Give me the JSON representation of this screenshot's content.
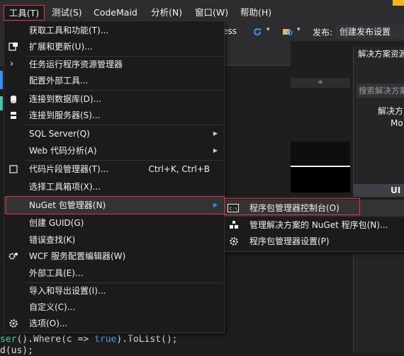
{
  "menubar": {
    "tools": "工具(T)",
    "test": "测试(S)",
    "codemaid": "CodeMaid",
    "analyze": "分析(N)",
    "window": "窗口(W)",
    "help": "帮助(H)"
  },
  "toolbar": {
    "config_suffix": "ess",
    "publish_label": "发布:",
    "publish_value": "创建发布设置"
  },
  "solution_explorer": {
    "title": "解决方案资源",
    "search_placeholder": "搜索解决方案",
    "items": [
      "解决方",
      "Mo",
      "UI"
    ]
  },
  "tools_menu": {
    "items": [
      {
        "label": "获取工具和功能(T)...",
        "icon": "none"
      },
      {
        "label": "扩展和更新(U)...",
        "icon": "extensions-icon"
      },
      {
        "label": "任务运行程序资源管理器",
        "icon": "chevron-right-icon"
      },
      {
        "label": "配置外部工具...",
        "icon": "none"
      },
      {
        "label": "连接到数据库(D)...",
        "icon": "database-icon"
      },
      {
        "label": "连接到服务器(S)...",
        "icon": "server-icon"
      },
      {
        "label": "SQL Server(Q)",
        "icon": "none",
        "submenu": true
      },
      {
        "label": "Web 代码分析(A)",
        "icon": "none",
        "submenu": true
      },
      {
        "label": "代码片段管理器(T)...",
        "icon": "checkbox-icon",
        "shortcut": "Ctrl+K, Ctrl+B"
      },
      {
        "label": "选择工具箱项(X)...",
        "icon": "none"
      },
      {
        "label": "NuGet 包管理器(N)",
        "icon": "none",
        "submenu": true
      },
      {
        "label": "创建 GUID(G)",
        "icon": "none"
      },
      {
        "label": "错误查找(K)",
        "icon": "none"
      },
      {
        "label": "WCF 服务配置编辑器(W)",
        "icon": "gear-pair-icon"
      },
      {
        "label": "外部工具(E)...",
        "icon": "none"
      },
      {
        "label": "导入和导出设置(I)...",
        "icon": "none"
      },
      {
        "label": "自定义(C)...",
        "icon": "none"
      },
      {
        "label": "选项(O)...",
        "icon": "gear-icon"
      }
    ]
  },
  "nuget_submenu": {
    "items": [
      {
        "label": "程序包管理器控制台(O)",
        "icon": "console-icon"
      },
      {
        "label": "管理解决方案的 NuGet 程序包(N)...",
        "icon": "packages-icon"
      },
      {
        "label": "程序包管理器设置(P)",
        "icon": "gear-icon"
      }
    ]
  },
  "code": {
    "line1_a": "ser",
    "line1_b": "().Where(c => ",
    "line1_kw": "true",
    "line1_c": ").ToList();",
    "line2": "d(us);"
  },
  "colors": {
    "highlight_border": "#e0393e",
    "menu_bg": "#1b1b1c",
    "chrome_bg": "#2d2d30",
    "accent": "#f0b81e"
  }
}
